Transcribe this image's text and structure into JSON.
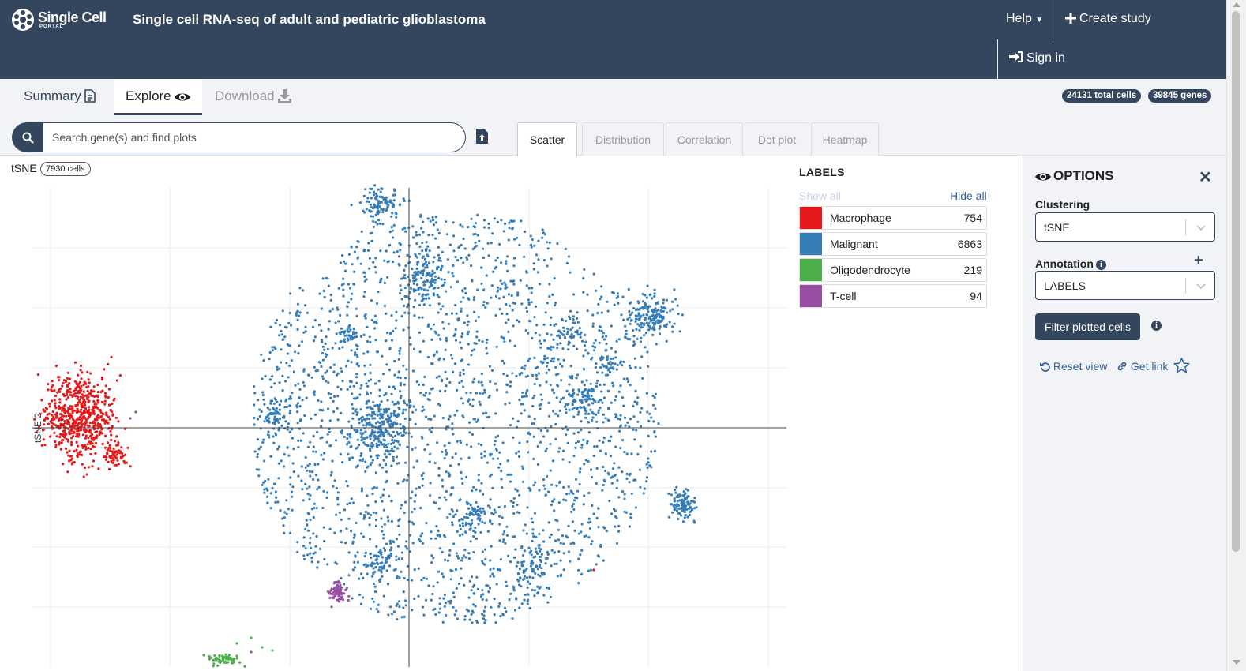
{
  "app": {
    "logo_line1": "Single Cell",
    "logo_line2": "PORTAL",
    "study_title": "Single cell RNA-seq of adult and pediatric glioblastoma"
  },
  "nav": {
    "help": "Help",
    "create_study": "Create study",
    "sign_in": "Sign in"
  },
  "tabs": [
    {
      "label": "Summary"
    },
    {
      "label": "Explore"
    },
    {
      "label": "Download"
    }
  ],
  "stats": {
    "total_cells": "24131 total cells",
    "genes": "39845 genes"
  },
  "search": {
    "placeholder": "Search gene(s) and find plots"
  },
  "plot_tabs": [
    {
      "label": "Scatter"
    },
    {
      "label": "Distribution"
    },
    {
      "label": "Correlation"
    },
    {
      "label": "Dot plot"
    },
    {
      "label": "Heatmap"
    }
  ],
  "plot": {
    "title": "tSNE",
    "cells_badge": "7930 cells",
    "ylabel": "tSNE 2"
  },
  "legend": {
    "title": "LABELS",
    "show_all": "Show all",
    "hide_all": "Hide all",
    "items": [
      {
        "name": "Macrophage",
        "count": "754",
        "color": "#e41a1c"
      },
      {
        "name": "Malignant",
        "count": "6863",
        "color": "#377eb8"
      },
      {
        "name": "Oligodendrocyte",
        "count": "219",
        "color": "#4daf4a"
      },
      {
        "name": "T-cell",
        "count": "94",
        "color": "#984ea3"
      }
    ]
  },
  "options": {
    "title": "OPTIONS",
    "clustering_label": "Clustering",
    "clustering_value": "tSNE",
    "annotation_label": "Annotation",
    "annotation_value": "LABELS",
    "filter_button": "Filter plotted cells",
    "reset_view": "Reset view",
    "get_link": "Get link"
  },
  "chart_data": {
    "type": "scatter",
    "title": "tSNE",
    "ylabel": "tSNE 2",
    "series": [
      {
        "name": "Macrophage",
        "color": "#e41a1c",
        "count": 754
      },
      {
        "name": "Malignant",
        "color": "#377eb8",
        "count": 6863
      },
      {
        "name": "Oligodendrocyte",
        "color": "#4daf4a",
        "count": 219
      },
      {
        "name": "T-cell",
        "color": "#984ea3",
        "count": 94
      }
    ],
    "grid": true,
    "legend": "right"
  },
  "colors": {
    "brand": "#34465d",
    "link": "#34619c",
    "panel_bg": "#f1f3f6"
  }
}
